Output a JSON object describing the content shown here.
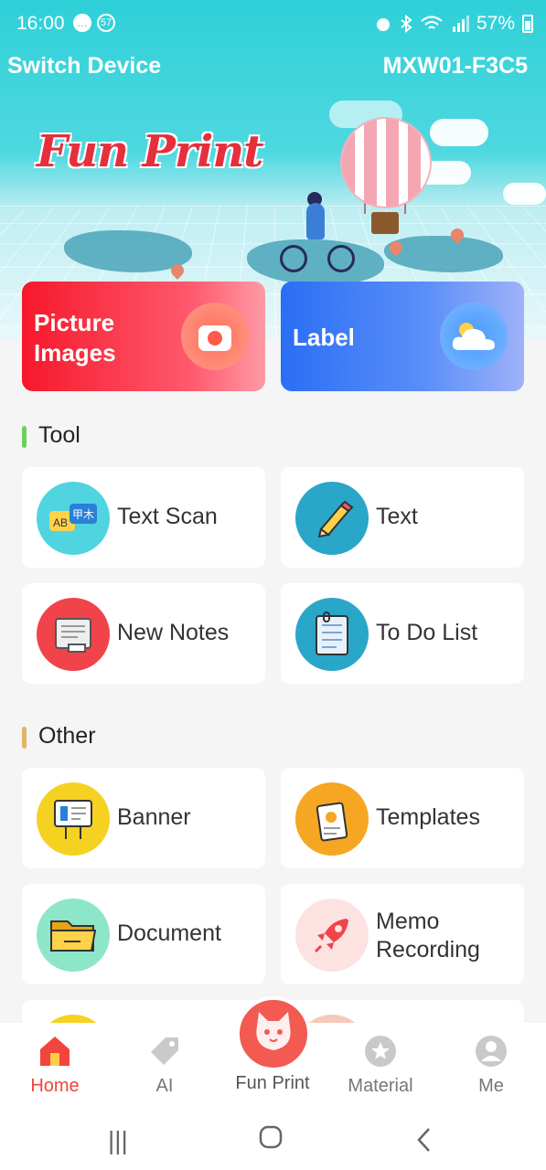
{
  "status_bar": {
    "time": "16:00",
    "notification_count": "57",
    "battery": "57%"
  },
  "header": {
    "switch_device": "Switch Device",
    "device_id": "MXW01-F3C5",
    "logo_text": "Fun Print"
  },
  "primary_cards": [
    {
      "line1": "Picture",
      "line2": "Images",
      "icon": "camera-icon",
      "color": "#f7182b"
    },
    {
      "label": "Label",
      "icon": "cloud-icon",
      "color": "#2a6ef5"
    }
  ],
  "tool_section": {
    "title": "Tool",
    "accent": "#6ad15a",
    "items": [
      {
        "label": "Text Scan",
        "icon": "text-scan-icon",
        "color": "#4fd4e0"
      },
      {
        "label": "Text",
        "icon": "pencil-icon",
        "color": "#2aa6c8"
      },
      {
        "label": "New Notes",
        "icon": "notes-icon",
        "color": "#f0434a"
      },
      {
        "label": "To Do List",
        "icon": "todo-list-icon",
        "color": "#2aa6c8"
      }
    ]
  },
  "other_section": {
    "title": "Other",
    "accent": "#e0b46a",
    "items": [
      {
        "label": "Banner",
        "icon": "banner-icon",
        "color": "#f5d221"
      },
      {
        "label": "Templates",
        "icon": "templates-icon",
        "color": "#f5a623"
      },
      {
        "label": "Document",
        "icon": "folder-icon",
        "color": "#8ee6c8"
      },
      {
        "label_line1": "Memo",
        "label_line2": "Recording",
        "icon": "rocket-icon",
        "color": "#fde2e2"
      }
    ]
  },
  "bottom_nav": {
    "home": "Home",
    "ai": "AI",
    "fun_print": "Fun Print",
    "material": "Material",
    "me": "Me",
    "active_color": "#f1453d"
  }
}
